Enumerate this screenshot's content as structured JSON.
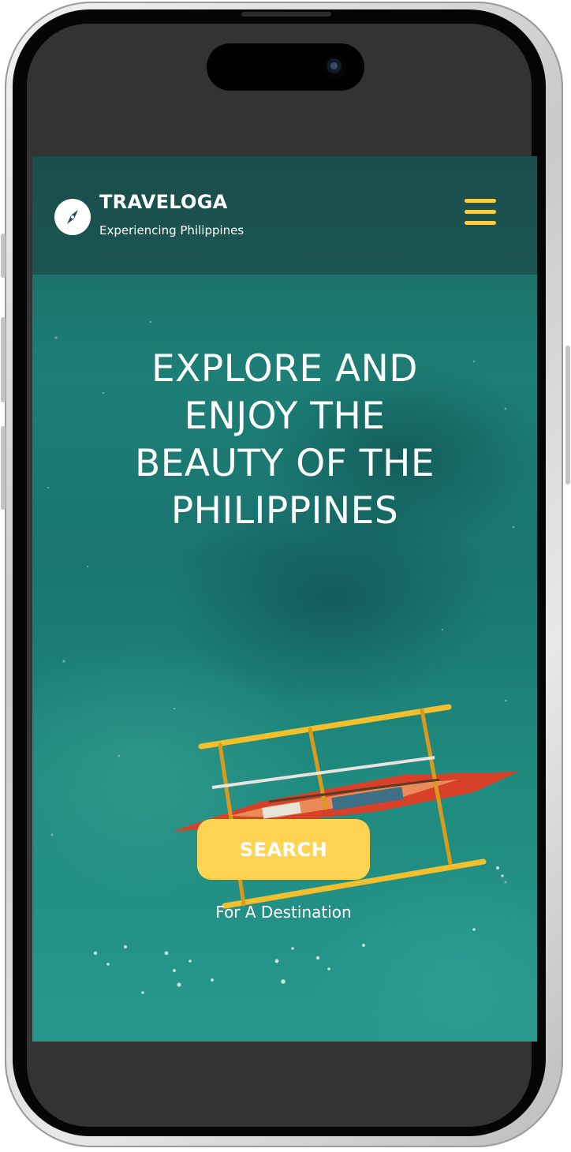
{
  "header": {
    "brand_name": "TRAVELOGA",
    "tagline": "Experiencing Philippines",
    "logo_icon": "compass-icon",
    "menu_icon": "hamburger-menu-icon"
  },
  "hero": {
    "title": "EXPLORE AND\nENJOY THE\nBEAUTY OF THE\nPHILIPPINES",
    "background_image": "aerial view of outrigger boat on turquoise sea"
  },
  "cta": {
    "search_label": "SEARCH",
    "caption": "For A Destination"
  },
  "colors": {
    "accent": "#ffd453",
    "menu_icon": "#f7cf45",
    "header_overlay": "#1c3234",
    "sea": "#1d7f76",
    "text": "#ffffff"
  }
}
